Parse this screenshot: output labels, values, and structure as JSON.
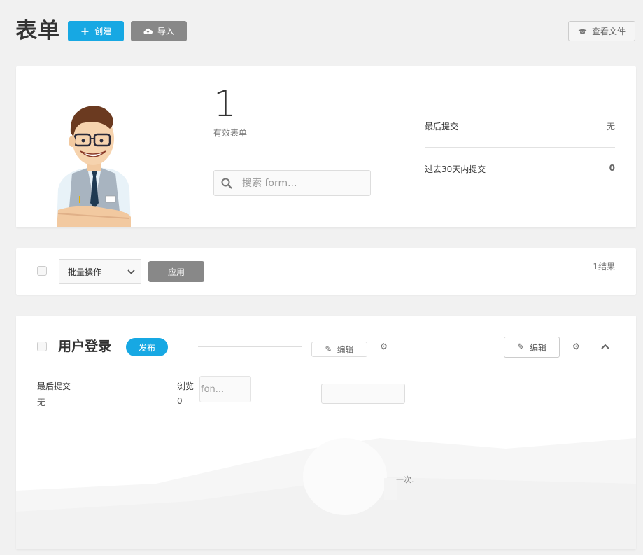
{
  "header": {
    "title": "表单",
    "create_label": "创建",
    "import_label": "导入",
    "docs_label": "查看文件"
  },
  "summary": {
    "active_count": "1",
    "active_label": "有效表单",
    "search_placeholder": "搜索 form...",
    "last_submission_label": "最后提交",
    "last_submission_value": "无",
    "submissions_30d_label": "过去30天内提交",
    "submissions_30d_value": "0"
  },
  "bulk": {
    "select_value": "批量操作",
    "apply_label": "应用",
    "result_count": "1结果"
  },
  "form": {
    "title": "用户登录",
    "status_badge": "发布",
    "edit_label_ghost": "编辑",
    "edit_label": "编辑",
    "last_submission_label": "最后提交",
    "last_submission_value": "无",
    "views_label": "浏览",
    "views_value": "0",
    "ghost_input_text": "fon...",
    "ghost_trailing_text": "一次."
  },
  "colors": {
    "accent": "#17a8e3",
    "neutral_button": "#888888",
    "background": "#f1f1f1"
  },
  "icons": {
    "create": "plus-icon",
    "import": "cloud-upload-icon",
    "docs": "graduation-cap-icon",
    "search": "search-icon",
    "edit": "pencil-icon",
    "settings": "gear-icon",
    "collapse": "chevron-up-icon",
    "select": "chevron-down-icon"
  }
}
